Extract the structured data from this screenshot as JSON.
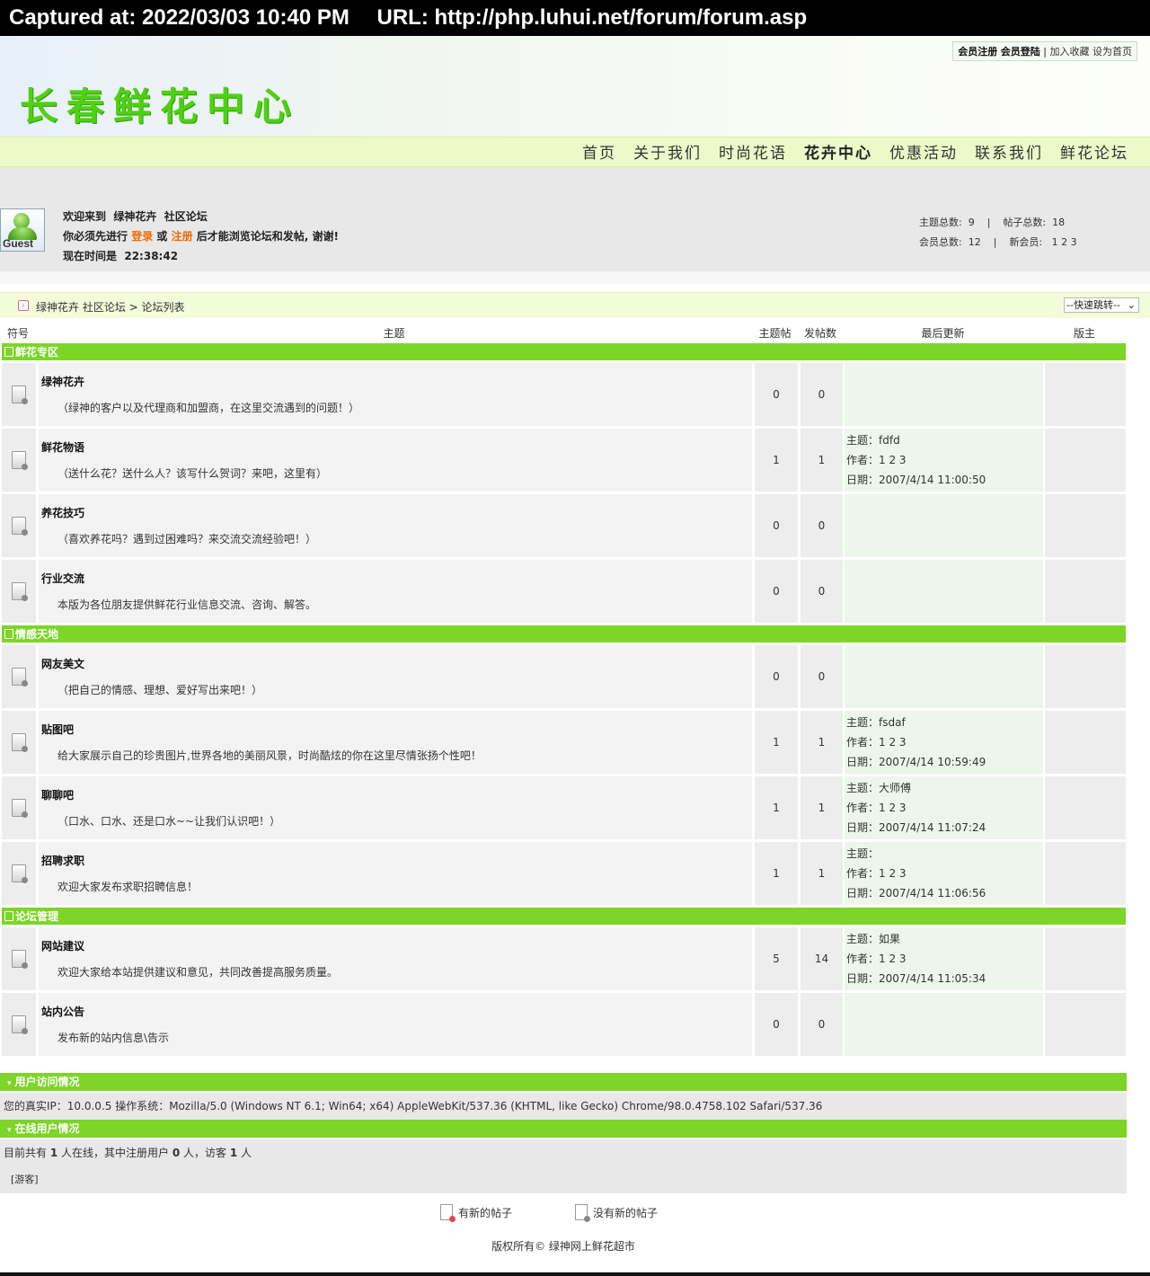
{
  "capture": {
    "captured_at": "Captured at: 2022/03/03 10:40 PM",
    "url": "URL: http://php.luhui.net/forum/forum.asp"
  },
  "header": {
    "site_name": "长春鲜花中心",
    "top_links": {
      "register": "会员注册",
      "login": "会员登陆",
      "separator": "|",
      "bookmark": "加入收藏",
      "homepage": "设为首页"
    },
    "nav": [
      "首页",
      "关于我们",
      "时尚花语",
      "花卉中心",
      "优惠活动",
      "联系我们",
      "鲜花论坛"
    ]
  },
  "welcome": {
    "avatar_label": "Guest",
    "line1": "欢迎来到  绿神花卉  社区论坛",
    "line2_prefix": "你必须先进行 ",
    "login": "登录",
    "or": " 或 ",
    "register": "注册",
    "line2_suffix": " 后才能浏览论坛和发帖, 谢谢!",
    "time_label": "现在时间是  ",
    "time_value": "22:38:42"
  },
  "stats": {
    "topics_label": "主题总数:",
    "topics": "9",
    "posts_label": "帖子总数:",
    "posts": "18",
    "members_label": "会员总数:",
    "members": "12",
    "new_member_label": "新会员:",
    "new_member": "1 2 3",
    "sep": "|"
  },
  "breadcrumb": {
    "text": "绿神花卉 社区论坛 > 论坛列表",
    "jump": "--快速跳转--"
  },
  "table": {
    "headers": {
      "symbol": "符号",
      "topic": "主题",
      "topic_posts": "主题帖",
      "posts": "发帖数",
      "last_update": "最后更新",
      "moderator": "版主"
    },
    "categories": [
      {
        "name": "鲜花专区",
        "forums": [
          {
            "name": "绿神花卉",
            "desc": "（绿神的客户以及代理商和加盟商，在这里交流遇到的问题！）",
            "topics": "0",
            "posts": "0",
            "last": null
          },
          {
            "name": "鲜花物语",
            "desc": "（送什么花？送什么人？该写什么贺词？来吧，这里有）",
            "topics": "1",
            "posts": "1",
            "last": {
              "topic": "主题：fdfd",
              "author": "作者：1 2 3",
              "date": "日期：2007/4/14 11:00:50"
            }
          },
          {
            "name": "养花技巧",
            "desc": "（喜欢养花吗？遇到过困难吗？来交流交流经验吧！）",
            "topics": "0",
            "posts": "0",
            "last": null
          },
          {
            "name": "行业交流",
            "desc": "本版为各位朋友提供鲜花行业信息交流、咨询、解答。",
            "topics": "0",
            "posts": "0",
            "last": null
          }
        ]
      },
      {
        "name": "情感天地",
        "forums": [
          {
            "name": "网友美文",
            "desc": "（把自己的情感、理想、爱好写出来吧！）",
            "topics": "0",
            "posts": "0",
            "last": null
          },
          {
            "name": "贴图吧",
            "desc": "给大家展示自己的珍贵图片,世界各地的美丽风景，时尚酷炫的你在这里尽情张扬个性吧！",
            "topics": "1",
            "posts": "1",
            "last": {
              "topic": "主题：fsdaf",
              "author": "作者：1 2 3",
              "date": "日期：2007/4/14 10:59:49"
            }
          },
          {
            "name": "聊聊吧",
            "desc": "（口水、口水、还是口水~~让我们认识吧！）",
            "topics": "1",
            "posts": "1",
            "last": {
              "topic": "主题：大师傅",
              "author": "作者：1 2 3",
              "date": "日期：2007/4/14 11:07:24"
            }
          },
          {
            "name": "招聘求职",
            "desc": "欢迎大家发布求职招聘信息！",
            "topics": "1",
            "posts": "1",
            "last": {
              "topic": "主题：",
              "author": "作者：1 2 3",
              "date": "日期：2007/4/14 11:06:56"
            }
          }
        ]
      },
      {
        "name": "论坛管理",
        "forums": [
          {
            "name": "网站建议",
            "desc": "欢迎大家给本站提供建议和意见，共同改善提高服务质量。",
            "topics": "5",
            "posts": "14",
            "last": {
              "topic": "主题：如果",
              "author": "作者：1 2 3",
              "date": "日期：2007/4/14 11:05:34"
            }
          },
          {
            "name": "站内公告",
            "desc": "发布新的站内信息\\告示",
            "topics": "0",
            "posts": "0",
            "last": null
          }
        ]
      }
    ]
  },
  "visit": {
    "title": "用户访问情况",
    "text": "您的真实IP：10.0.0.5  操作系统：Mozilla/5.0 (Windows NT 6.1; Win64; x64) AppleWebKit/537.36 (KHTML, like Gecko) Chrome/98.0.4758.102 Safari/537.36"
  },
  "online": {
    "title": "在线用户情况",
    "t1": "目前共有 ",
    "total": "1",
    "t2": " 人在线，其中注册用户 ",
    "registered": "0",
    "t3": " 人，访客 ",
    "guests": "1",
    "t4": " 人",
    "guest_tag": "[游客]"
  },
  "legend": {
    "new_posts": "有新的帖子",
    "no_new_posts": "没有新的帖子"
  },
  "footer": {
    "copyright": "版权所有© 绿神网上鲜花超市"
  }
}
